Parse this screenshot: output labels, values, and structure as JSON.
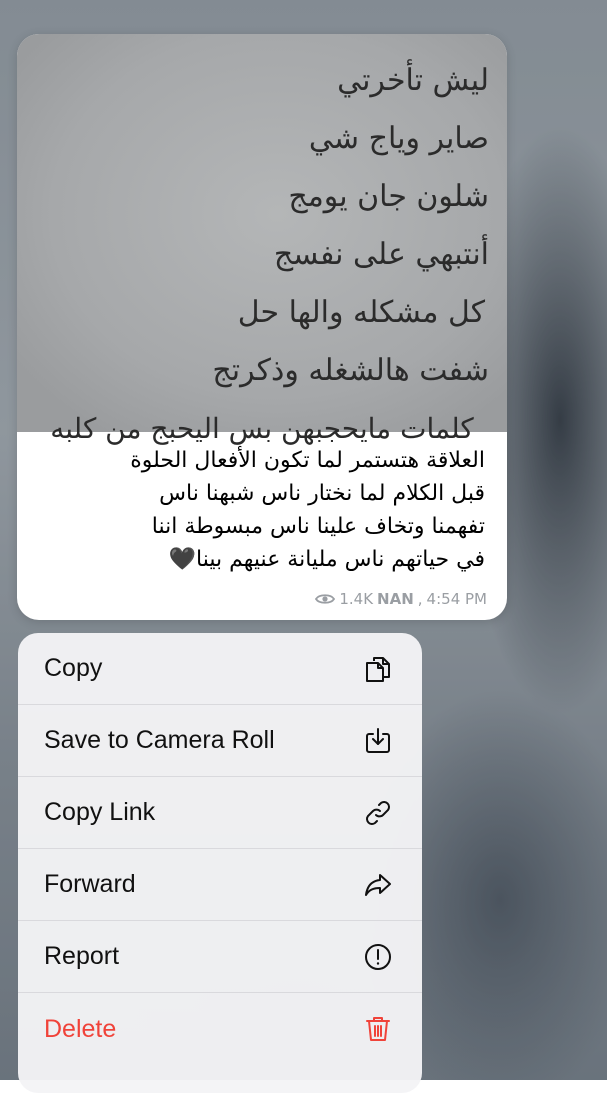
{
  "message": {
    "photo_text_lines": [
      "ليش تأخرتي",
      "صاير وياج شي",
      "شلون جان يومج",
      "أنتبهي على نفسج",
      "كل مشكله والها حل",
      "شفت هالشغله وذكرتج",
      "كلمات مايحجبهن بس اليحبج من كلبه"
    ],
    "caption_lines": [
      "العلاقة هتستمر لما تكون الأفعال الحلوة",
      "قبل الكلام لما نختار ناس شبهنا ناس",
      "تفهمنا وتخاف علينا ناس مبسوطة اننا",
      "في حياتهم ناس مليانة عنيهم بينا🖤"
    ],
    "views": "1.4K",
    "author": "NAN",
    "time": "4:54 PM"
  },
  "context_menu": {
    "items": [
      {
        "label": "Copy",
        "icon": "copy-icon"
      },
      {
        "label": "Save to Camera Roll",
        "icon": "save-icon"
      },
      {
        "label": "Copy Link",
        "icon": "link-icon"
      },
      {
        "label": "Forward",
        "icon": "forward-icon"
      },
      {
        "label": "Report",
        "icon": "report-icon"
      },
      {
        "label": "Delete",
        "icon": "trash-icon"
      }
    ]
  },
  "colors": {
    "danger": "#f0433a",
    "meta": "#9a9ea3"
  }
}
